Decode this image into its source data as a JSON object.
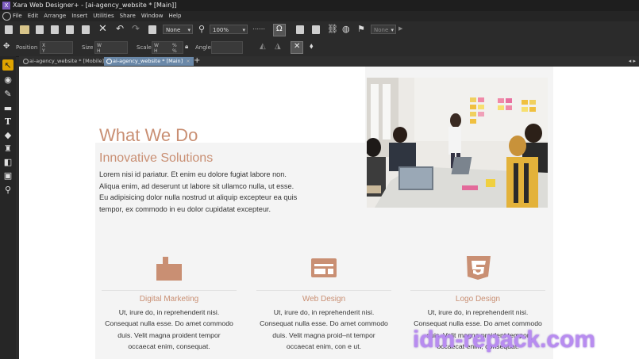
{
  "app": {
    "window_title": "Xara Web Designer+ - [ai-agency_website * [Main]]",
    "logo_letter": "X"
  },
  "menu": {
    "items": [
      "File",
      "Edit",
      "Arrange",
      "Insert",
      "Utilities",
      "Share",
      "Window",
      "Help"
    ]
  },
  "toolbar": {
    "fill_select": "None",
    "zoom_select": "100%",
    "style_select": "None",
    "position_label": "Position",
    "size_label": "Size",
    "scale_label": "Scale",
    "angle_label": "Angle",
    "x_label": "X",
    "y_label": "Y",
    "w_label": "W",
    "h_label": "H",
    "percent_label": "%"
  },
  "tabs": [
    {
      "label": "ai-agency_website * [Mobile]",
      "close": "×",
      "active": false
    },
    {
      "label": "ai-agency_website * [Main]",
      "close": "×",
      "active": true
    }
  ],
  "tabs_plus": "+",
  "tabs_scroll": "◂ ▸",
  "tools": [
    {
      "name": "selector-tool",
      "glyph": "↖",
      "selected": true
    },
    {
      "name": "photo-tool",
      "glyph": "◉",
      "selected": false
    },
    {
      "name": "pen-tool",
      "glyph": "✎",
      "selected": false
    },
    {
      "name": "rectangle-tool",
      "glyph": "▬",
      "selected": false
    },
    {
      "name": "text-tool",
      "glyph": "T",
      "selected": false
    },
    {
      "name": "fill-tool",
      "glyph": "◆",
      "selected": false
    },
    {
      "name": "transparency-tool",
      "glyph": "♜",
      "selected": false
    },
    {
      "name": "shadow-tool",
      "glyph": "◧",
      "selected": false
    },
    {
      "name": "mould-tool",
      "glyph": "▣",
      "selected": false
    },
    {
      "name": "zoom-tool",
      "glyph": "⚲",
      "selected": false
    }
  ],
  "page": {
    "heading": "What We Do",
    "subheading": "Innovative Solutions",
    "paragraph_lines": [
      "Lorem nisi id pariatur. Et enim eu dolore fugiat labore non.",
      "Aliqua enim, ad deserunt ut labore sit ullamco nulla, ut esse.",
      "Eu adipisicing dolor nulla nostrud ut aliquip excepteur ea quis",
      "tempor, ex commodo in eu dolor cupidatat excepteur."
    ],
    "services": [
      {
        "title": "Digital Marketing",
        "icon": "briefcase-icon",
        "lines": [
          "Ut, irure do, in reprehenderit nisi.",
          "Consequat nulla esse. Do amet commodo",
          "duis. Velit magna proident tempor",
          "occaecat enim, consequat."
        ]
      },
      {
        "title": "Web Design",
        "icon": "browser-window-icon",
        "lines": [
          "Ut, irure do, in reprehenderit nisi.",
          "Consequat nulla esse. Do amet commodo",
          "duis. Velit magna proid–nt tempor",
          "occaecat enim, con e  ut."
        ]
      },
      {
        "title": "Logo Design",
        "icon": "css3-shield-icon",
        "lines": [
          "Ut, irure do, in reprehenderit nisi.",
          "Consequat nulla esse. Do amet commodo",
          "duis. Velit magna proident tempor",
          "occaecat enim, consequat."
        ]
      }
    ]
  },
  "colors": {
    "accent": "#c98f73",
    "tool_selected": "#e0a400",
    "active_tab": "#6a88a8"
  },
  "watermark": "idm-repack.com"
}
